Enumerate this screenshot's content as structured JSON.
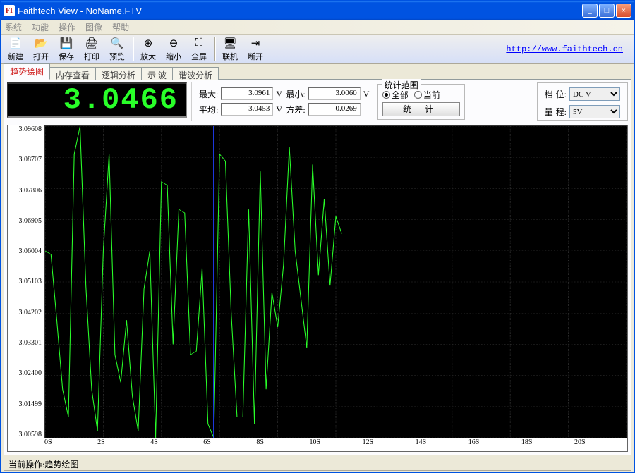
{
  "window": {
    "title": "Faithtech View - NoName.FTV"
  },
  "menu": {
    "system": "系统",
    "function": "功能",
    "operate": "操作",
    "image": "图像",
    "help": "帮助"
  },
  "toolbar": {
    "new": "新建",
    "open": "打开",
    "save": "保存",
    "print": "打印",
    "preview": "预览",
    "zoomin": "放大",
    "zoomout": "缩小",
    "full": "全屏",
    "connect": "联机",
    "disconnect": "断开",
    "link": "http://www.faithtech.cn"
  },
  "tabs": {
    "trend": "趋势绘图",
    "mem": "内存查看",
    "logic": "逻辑分析",
    "scope": "示    波",
    "harm": "谐波分析"
  },
  "lcd": {
    "value": "3.0466"
  },
  "stats": {
    "max_lbl": "最大:",
    "max_val": "3.0961",
    "v": "V",
    "min_lbl": "最小:",
    "min_val": "3.0060",
    "avg_lbl": "平均:",
    "avg_val": "3.0453",
    "var_lbl": "方差:",
    "var_val": "0.0269"
  },
  "stat_range": {
    "legend": "统计范围",
    "all": "全部",
    "current": "当前",
    "btn": "统  计"
  },
  "range": {
    "col1_top": "档",
    "col1_bot": "量",
    "pos_lbl": "位:",
    "rng_lbl": "程:",
    "pos_val": "DC V",
    "rng_val": "5V"
  },
  "chart_data": {
    "type": "line",
    "title": "",
    "xlabel": "",
    "ylabel": "",
    "ylim": [
      3.00598,
      3.09608
    ],
    "yticks": [
      3.09608,
      3.08707,
      3.07806,
      3.06905,
      3.06004,
      3.05103,
      3.04202,
      3.03301,
      3.024,
      3.01499,
      3.00598
    ],
    "xticks": [
      "0S",
      "2S",
      "4S",
      "6S",
      "8S",
      "10S",
      "12S",
      "14S",
      "16S",
      "18S",
      "20S"
    ],
    "xlim": [
      0,
      20
    ],
    "cursor_x": 5.8,
    "x": [
      0.0,
      0.2,
      0.4,
      0.6,
      0.8,
      1.0,
      1.2,
      1.4,
      1.6,
      1.8,
      2.0,
      2.2,
      2.4,
      2.6,
      2.8,
      3.0,
      3.2,
      3.4,
      3.6,
      3.8,
      4.0,
      4.2,
      4.4,
      4.6,
      4.8,
      5.0,
      5.2,
      5.4,
      5.6,
      5.8,
      6.0,
      6.2,
      6.4,
      6.6,
      6.8,
      7.0,
      7.2,
      7.4,
      7.6,
      7.8,
      8.0,
      8.2,
      8.4,
      8.6,
      8.8,
      9.0,
      9.2,
      9.4,
      9.6,
      9.8,
      10.0,
      10.2
    ],
    "values": [
      3.06,
      3.059,
      3.04,
      3.02,
      3.012,
      3.088,
      3.096,
      3.05,
      3.02,
      3.008,
      3.06,
      3.088,
      3.03,
      3.022,
      3.04,
      3.018,
      3.008,
      3.049,
      3.06,
      3.006,
      3.08,
      3.079,
      3.033,
      3.072,
      3.071,
      3.03,
      3.031,
      3.055,
      3.01,
      3.006,
      3.088,
      3.086,
      3.042,
      3.012,
      3.012,
      3.072,
      3.01,
      3.083,
      3.02,
      3.048,
      3.038,
      3.056,
      3.09,
      3.06,
      3.046,
      3.032,
      3.085,
      3.053,
      3.075,
      3.05,
      3.07,
      3.065
    ]
  },
  "status": {
    "label": "当前操作:",
    "value": "趋势绘图"
  }
}
